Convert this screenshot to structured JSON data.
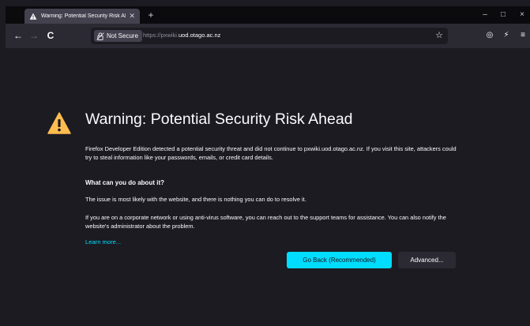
{
  "tab": {
    "title": "Warning: Potential Security Risk Ahead",
    "close_icon": "close-icon",
    "new_tab_icon": "plus-icon"
  },
  "window_controls": {
    "minimize": "–",
    "maximize": "□",
    "close": "×"
  },
  "navbar": {
    "back_icon": "←",
    "forward_icon": "→",
    "reload_icon": "C",
    "security_label": "Not Secure",
    "url_prefix": "https://pxwiki.",
    "url_domain": "uod.otago.ac.nz",
    "bookmark_icon": "☆",
    "pocket_icon": "◎",
    "tools_icon": "⚡",
    "menu_icon": "≡"
  },
  "page": {
    "heading": "Warning: Potential Security Risk Ahead",
    "para1": "Firefox Developer Edition detected a potential security threat and did not continue to pxwiki.uod.otago.ac.nz. If you visit this site, attackers could try to steal information like your passwords, emails, or credit card details.",
    "subhead": "What can you do about it?",
    "para2": "The issue is most likely with the website, and there is nothing you can do to resolve it.",
    "para3": "If you are on a corporate network or using anti-virus software, you can reach out to the support teams for assistance. You can also notify the website's administrator about the problem.",
    "learn_more": "Learn more...",
    "go_back_label": "Go Back (Recommended)",
    "advanced_label": "Advanced..."
  },
  "colors": {
    "accent": "#00ddff",
    "warning": "#ffbd4f",
    "background": "#1c1b22"
  }
}
